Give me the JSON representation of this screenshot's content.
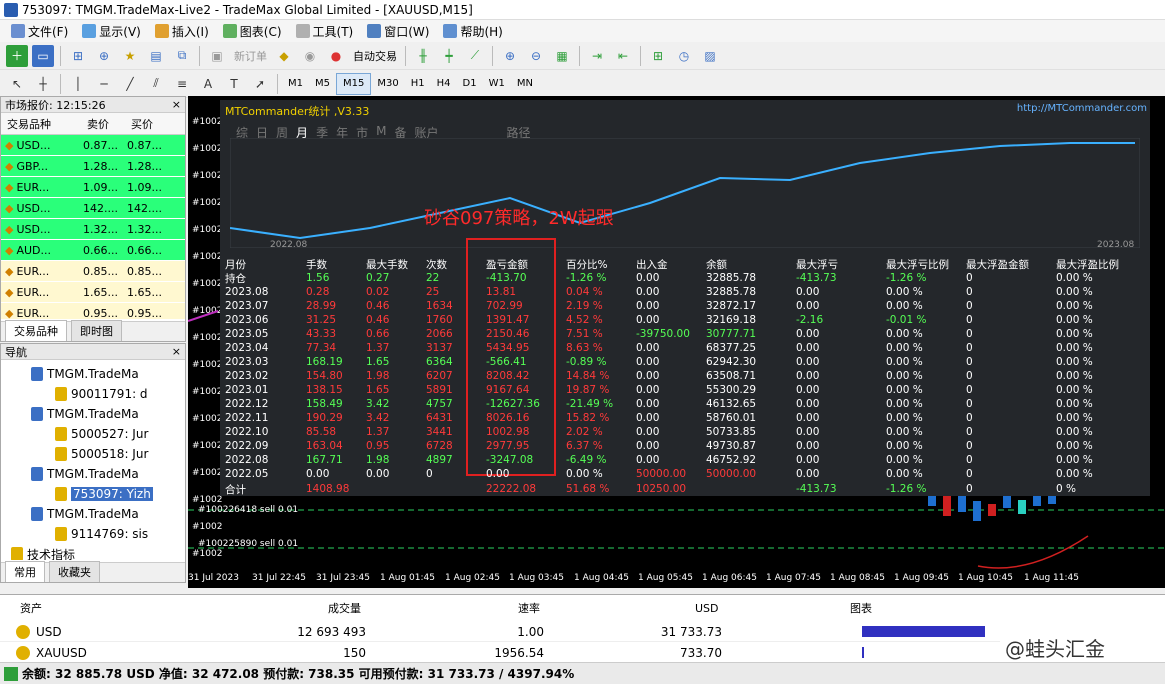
{
  "window": {
    "title": "753097: TMGM.TradeMax-Live2 - TradeMax Global Limited - [XAUUSD,M15]"
  },
  "menu": [
    "文件(F)",
    "显示(V)",
    "插入(I)",
    "图表(C)",
    "工具(T)",
    "窗口(W)",
    "帮助(H)"
  ],
  "toolbar": {
    "new_order": "新订单",
    "auto_trade": "自动交易"
  },
  "timeframes": [
    "M1",
    "M5",
    "M15",
    "M30",
    "H1",
    "H4",
    "D1",
    "W1",
    "MN"
  ],
  "selected_timeframe": "M15",
  "market_watch": {
    "title": "市场报价: 12:15:26",
    "cols": [
      "交易品种",
      "卖价",
      "买价"
    ],
    "rows": [
      {
        "sym": "USD...",
        "bid": "0.87...",
        "ask": "0.87...",
        "color": "#2aff7a"
      },
      {
        "sym": "GBP...",
        "bid": "1.28...",
        "ask": "1.28...",
        "color": "#2aff7a"
      },
      {
        "sym": "EUR...",
        "bid": "1.09...",
        "ask": "1.09...",
        "color": "#2aff7a"
      },
      {
        "sym": "USD...",
        "bid": "142....",
        "ask": "142....",
        "color": "#2aff7a"
      },
      {
        "sym": "USD...",
        "bid": "1.32...",
        "ask": "1.32...",
        "color": "#2aff7a"
      },
      {
        "sym": "AUD...",
        "bid": "0.66...",
        "ask": "0.66...",
        "color": "#2aff7a"
      },
      {
        "sym": "EUR...",
        "bid": "0.85...",
        "ask": "0.85...",
        "color": "#fff8d0"
      },
      {
        "sym": "EUR...",
        "bid": "1.65...",
        "ask": "1.65...",
        "color": "#fff8d0"
      },
      {
        "sym": "EUR...",
        "bid": "0.95...",
        "ask": "0.95...",
        "color": "#fff8d0"
      }
    ],
    "tabs": [
      "交易品种",
      "即时图"
    ]
  },
  "navigator": {
    "title": "导航",
    "items": [
      {
        "label": "TMGM.TradeMa",
        "type": "server"
      },
      {
        "label": "90011791: d",
        "type": "account"
      },
      {
        "label": "TMGM.TradeMa",
        "type": "server"
      },
      {
        "label": "5000527: Jur",
        "type": "account"
      },
      {
        "label": "5000518: Jur",
        "type": "account"
      },
      {
        "label": "TMGM.TradeMa",
        "type": "server"
      },
      {
        "label": "753097: Yizh",
        "type": "account-sel"
      },
      {
        "label": "TMGM.TradeMa",
        "type": "server"
      },
      {
        "label": "9114769: sis",
        "type": "account"
      },
      {
        "label": "技术指标",
        "type": "indicator"
      }
    ],
    "tabs": [
      "常用",
      "收藏夹"
    ]
  },
  "chart": {
    "symbol_tag": "XAUUSD",
    "order_labels": [
      "#100226418 sell 0.01",
      "#100225890 sell 0.01"
    ],
    "price_labels": [
      "#1002",
      "#1002",
      "#1002",
      "#1002",
      "#1002",
      "#1002",
      "#1002",
      "#1002",
      "#1002",
      "#1002",
      "#1002",
      "#1002",
      "#1002",
      "#1002",
      "#1002",
      "#1002",
      "#1002"
    ],
    "time_labels": [
      "31 Jul 2023",
      "31 Jul 22:45",
      "31 Jul 23:45",
      "1 Aug 01:45",
      "1 Aug 02:45",
      "1 Aug 03:45",
      "1 Aug 04:45",
      "1 Aug 05:45",
      "1 Aug 06:45",
      "1 Aug 07:45",
      "1 Aug 08:45",
      "1 Aug 09:45",
      "1 Aug 10:45",
      "1 Aug 11:45"
    ]
  },
  "stats": {
    "brand": "MTCommander统计 ,V3.33",
    "site": "http://MTCommander.com",
    "menu": [
      "综",
      "日",
      "周",
      "月",
      "季",
      "年",
      "市",
      "M",
      "备",
      "账户",
      "路径"
    ],
    "active_menu": "月",
    "curve_start": "2022.08",
    "curve_end": "2023.08",
    "annotation": "砂谷097策略，2W起跟",
    "headers": [
      "月份",
      "手数",
      "最大手数",
      "次数",
      "盈亏金额",
      "百分比%",
      "出入金",
      "余额",
      "最大浮亏",
      "最大浮亏比例",
      "最大浮盈金额",
      "最大浮盈比例"
    ],
    "rows": [
      [
        "持仓",
        "1.56",
        "0.27",
        "22",
        "-413.70",
        "-1.26 %",
        "0.00",
        "32885.78",
        "-413.73",
        "-1.26 %",
        "0",
        "0.00 %"
      ],
      [
        "2023.08",
        "0.28",
        "0.02",
        "25",
        "13.81",
        "0.04 %",
        "0.00",
        "32885.78",
        "0.00",
        "0.00 %",
        "0",
        "0.00 %"
      ],
      [
        "2023.07",
        "28.99",
        "0.46",
        "1634",
        "702.99",
        "2.19 %",
        "0.00",
        "32872.17",
        "0.00",
        "0.00 %",
        "0",
        "0.00 %"
      ],
      [
        "2023.06",
        "31.25",
        "0.46",
        "1760",
        "1391.47",
        "4.52 %",
        "0.00",
        "32169.18",
        "-2.16",
        "-0.01 %",
        "0",
        "0.00 %"
      ],
      [
        "2023.05",
        "43.33",
        "0.66",
        "2066",
        "2150.46",
        "7.51 %",
        "-39750.00",
        "30777.71",
        "0.00",
        "0.00 %",
        "0",
        "0.00 %"
      ],
      [
        "2023.04",
        "77.34",
        "1.37",
        "3137",
        "5434.95",
        "8.63 %",
        "0.00",
        "68377.25",
        "0.00",
        "0.00 %",
        "0",
        "0.00 %"
      ],
      [
        "2023.03",
        "168.19",
        "1.65",
        "6364",
        "-566.41",
        "-0.89 %",
        "0.00",
        "62942.30",
        "0.00",
        "0.00 %",
        "0",
        "0.00 %"
      ],
      [
        "2023.02",
        "154.80",
        "1.98",
        "6207",
        "8208.42",
        "14.84 %",
        "0.00",
        "63508.71",
        "0.00",
        "0.00 %",
        "0",
        "0.00 %"
      ],
      [
        "2023.01",
        "138.15",
        "1.65",
        "5891",
        "9167.64",
        "19.87 %",
        "0.00",
        "55300.29",
        "0.00",
        "0.00 %",
        "0",
        "0.00 %"
      ],
      [
        "2022.12",
        "158.49",
        "3.42",
        "4757",
        "-12627.36",
        "-21.49 %",
        "0.00",
        "46132.65",
        "0.00",
        "0.00 %",
        "0",
        "0.00 %"
      ],
      [
        "2022.11",
        "190.29",
        "3.42",
        "6431",
        "8026.16",
        "15.82 %",
        "0.00",
        "58760.01",
        "0.00",
        "0.00 %",
        "0",
        "0.00 %"
      ],
      [
        "2022.10",
        "85.58",
        "1.37",
        "3441",
        "1002.98",
        "2.02 %",
        "0.00",
        "50733.85",
        "0.00",
        "0.00 %",
        "0",
        "0.00 %"
      ],
      [
        "2022.09",
        "163.04",
        "0.95",
        "6728",
        "2977.95",
        "6.37 %",
        "0.00",
        "49730.87",
        "0.00",
        "0.00 %",
        "0",
        "0.00 %"
      ],
      [
        "2022.08",
        "167.71",
        "1.98",
        "4897",
        "-3247.08",
        "-6.49 %",
        "0.00",
        "46752.92",
        "0.00",
        "0.00 %",
        "0",
        "0.00 %"
      ],
      [
        "2022.05",
        "0.00",
        "0.00",
        "0",
        "0.00",
        "0.00 %",
        "50000.00",
        "50000.00",
        "0.00",
        "0.00 %",
        "0",
        "0.00 %"
      ]
    ],
    "total": [
      "合计",
      "1408.98",
      "",
      "",
      "22222.08",
      "51.68 %",
      "10250.00",
      "",
      "-413.73",
      "-1.26 %",
      "0",
      "0 %"
    ]
  },
  "terminal": {
    "headers": [
      "资产",
      "成交量",
      "速率",
      "USD",
      "图表"
    ],
    "rows": [
      {
        "asset": "USD",
        "vol": "12 693 493",
        "rate": "1.00",
        "usd": "31 733.73",
        "bar": 0.88
      },
      {
        "asset": "XAUUSD",
        "vol": "150",
        "rate": "1956.54",
        "usd": "733.70",
        "bar": 0.01
      }
    ],
    "balance": "余额: 32 885.78 USD  净值: 32 472.08  预付款: 738.35  可用预付款: 31 733.73 / 4397.94%",
    "watermark": "@蛙头汇金"
  }
}
